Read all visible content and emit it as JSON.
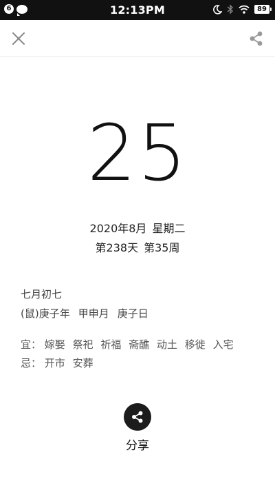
{
  "status_bar": {
    "time": "12:13PM",
    "notification_count": "6",
    "battery": "89"
  },
  "calendar": {
    "day": "25",
    "date": "2020年8月",
    "weekday": "星期二",
    "day_of_year": "第238天",
    "week_of_year": "第35周",
    "lunar_date": "七月初七",
    "ganzhi_year": "(鼠)庚子年",
    "ganzhi_month": "甲申月",
    "ganzhi_day": "庚子日",
    "yi_label": "宜：",
    "yi_items": [
      "嫁娶",
      "祭祀",
      "祈福",
      "斋醮",
      "动土",
      "移徙",
      "入宅"
    ],
    "ji_label": "忌：",
    "ji_items": [
      "开市",
      "安葬"
    ]
  },
  "share": {
    "label": "分享"
  },
  "icons": {
    "close": "close-icon",
    "share": "share-icon"
  },
  "colors": {
    "status_bar_bg": "#111111",
    "background": "#ffffff",
    "share_button_bg": "#1c1c1c"
  }
}
